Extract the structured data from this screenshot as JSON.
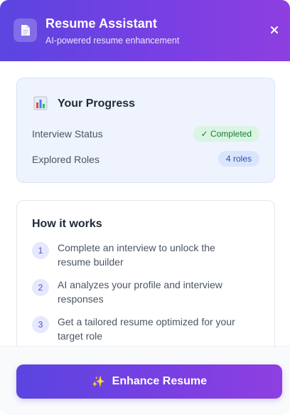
{
  "header": {
    "title": "Resume Assistant",
    "subtitle": "AI-powered resume enhancement",
    "icon": "document-icon",
    "close_icon": "close-icon"
  },
  "progress": {
    "title": "Your Progress",
    "icon": "bar-chart-icon",
    "rows": [
      {
        "label": "Interview Status",
        "badge": "✓ Completed",
        "badge_color": "#167a3c"
      },
      {
        "label": "Explored Roles",
        "badge": "4 roles",
        "badge_color": "#2b4fb8"
      }
    ]
  },
  "how_it_works": {
    "title": "How it works",
    "steps": [
      {
        "number": "1",
        "text": "Complete an interview to unlock the resume builder"
      },
      {
        "number": "2",
        "text": "AI analyzes your profile and interview responses"
      },
      {
        "number": "3",
        "text": "Get a tailored resume optimized for your target role"
      }
    ]
  },
  "footer": {
    "button_label": "Enhance Resume",
    "button_icon": "sparkles-icon"
  },
  "colors": {
    "accent_start": "#5b45e0",
    "accent_end": "#8e3fe0"
  }
}
